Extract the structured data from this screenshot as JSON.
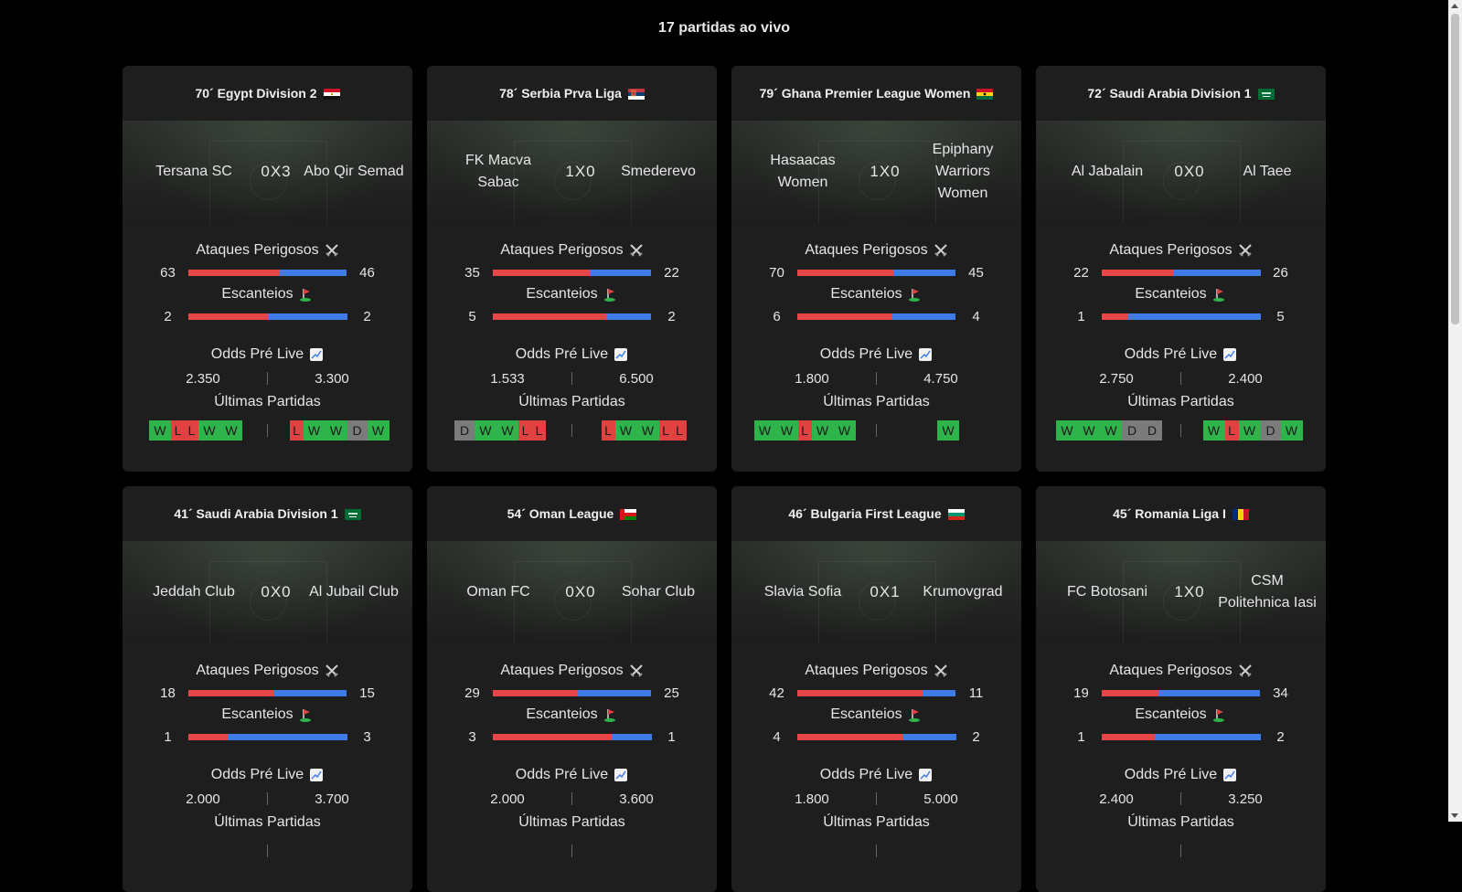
{
  "page": {
    "title": "17 partidas ao vivo"
  },
  "labels": {
    "attacks": "Ataques Perigosos",
    "corners": "Escanteios",
    "odds": "Odds Pré Live",
    "last": "Últimas Partidas"
  },
  "icons": {
    "attacks": "crossed-swords-icon",
    "corners": "corner-flag-icon",
    "odds": "chart-up-icon"
  },
  "colors": {
    "home_bar": "#e74646",
    "away_bar": "#3f7be6",
    "win": "#2fb34b",
    "loss": "#e04141",
    "draw": "#7b7b7b"
  },
  "matches": [
    {
      "minute_league": "70´ Egypt Division 2",
      "flag": "egypt",
      "home": "Tersana SC",
      "away": "Abo Qir Semad",
      "score": "0X3",
      "attacks": [
        "63",
        "46"
      ],
      "corners": [
        "2",
        "2"
      ],
      "odds": [
        "2.350",
        "3.300"
      ],
      "form_home": [
        "W",
        "L",
        "L",
        "W",
        "W"
      ],
      "form_away": [
        "L",
        "W",
        "W",
        "D",
        "W"
      ]
    },
    {
      "minute_league": "78´ Serbia Prva Liga",
      "flag": "serbia",
      "home": "FK Macva Sabac",
      "away": "Smederevo",
      "score": "1X0",
      "attacks": [
        "35",
        "22"
      ],
      "corners": [
        "5",
        "2"
      ],
      "odds": [
        "1.533",
        "6.500"
      ],
      "form_home": [
        "D",
        "W",
        "W",
        "L",
        "L"
      ],
      "form_away": [
        "L",
        "W",
        "W",
        "L",
        "L"
      ]
    },
    {
      "minute_league": "79´ Ghana Premier League Women",
      "flag": "ghana",
      "home": "Hasaacas Women",
      "away": "Epiphany Warriors Women",
      "score": "1X0",
      "attacks": [
        "70",
        "45"
      ],
      "corners": [
        "6",
        "4"
      ],
      "odds": [
        "1.800",
        "4.750"
      ],
      "form_home": [
        "W",
        "W",
        "L",
        "W",
        "W"
      ],
      "form_away": [
        "W"
      ]
    },
    {
      "minute_league": "72´ Saudi Arabia Division 1",
      "flag": "saudi",
      "home": "Al Jabalain",
      "away": "Al Taee",
      "score": "0X0",
      "attacks": [
        "22",
        "26"
      ],
      "corners": [
        "1",
        "5"
      ],
      "odds": [
        "2.750",
        "2.400"
      ],
      "form_home": [
        "W",
        "W",
        "W",
        "D",
        "D"
      ],
      "form_away": [
        "W",
        "L",
        "W",
        "D",
        "W"
      ]
    },
    {
      "minute_league": "41´ Saudi Arabia Division 1",
      "flag": "saudi",
      "home": "Jeddah Club",
      "away": "Al Jubail Club",
      "score": "0X0",
      "attacks": [
        "18",
        "15"
      ],
      "corners": [
        "1",
        "3"
      ],
      "odds": [
        "2.000",
        "3.700"
      ],
      "form_home": [],
      "form_away": []
    },
    {
      "minute_league": "54´ Oman League",
      "flag": "oman",
      "home": "Oman FC",
      "away": "Sohar Club",
      "score": "0X0",
      "attacks": [
        "29",
        "25"
      ],
      "corners": [
        "3",
        "1"
      ],
      "odds": [
        "2.000",
        "3.600"
      ],
      "form_home": [],
      "form_away": []
    },
    {
      "minute_league": "46´ Bulgaria First League",
      "flag": "bulgaria",
      "home": "Slavia Sofia",
      "away": "Krumovgrad",
      "score": "0X1",
      "attacks": [
        "42",
        "11"
      ],
      "corners": [
        "4",
        "2"
      ],
      "odds": [
        "1.800",
        "5.000"
      ],
      "form_home": [],
      "form_away": []
    },
    {
      "minute_league": "45´ Romania Liga I",
      "flag": "romania",
      "home": "FC Botosani",
      "away": "CSM Politehnica Iasi",
      "score": "1X0",
      "attacks": [
        "19",
        "34"
      ],
      "corners": [
        "1",
        "2"
      ],
      "odds": [
        "2.400",
        "3.250"
      ],
      "form_home": [],
      "form_away": []
    }
  ]
}
